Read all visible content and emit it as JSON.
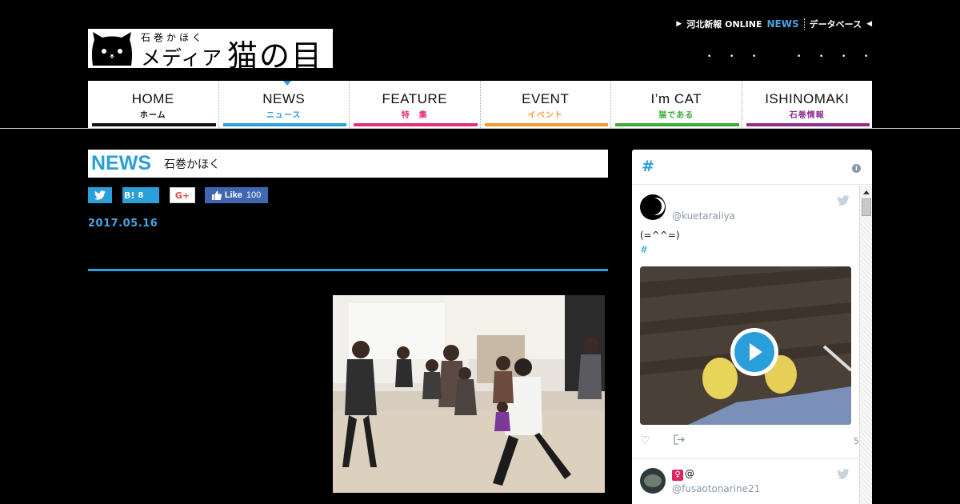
{
  "header": {
    "logo_prefix": "石巻かほく",
    "logo_media": "メディア",
    "logo_name": "猫の目",
    "toplinks": {
      "kahoku": "河北新報 ONLINE",
      "news": "NEWS",
      "database": "データベース"
    }
  },
  "nav": {
    "items": [
      {
        "en": "HOME",
        "jp": "ホーム",
        "color": "#111111"
      },
      {
        "en": "NEWS",
        "jp": "ニュース",
        "color": "#2b9fd9"
      },
      {
        "en": "FEATURE",
        "jp": "特　集",
        "color": "#e62e7b"
      },
      {
        "en": "EVENT",
        "jp": "イベント",
        "color": "#f29a2e"
      },
      {
        "en": "I’m CAT",
        "jp": "猫である",
        "color": "#3aab3a"
      },
      {
        "en": "ISHINOMAKI",
        "jp": "石巻情報",
        "color": "#8e2e8e"
      }
    ],
    "active": "NEWS"
  },
  "article": {
    "section_en": "NEWS",
    "section_jp": "石巻かほく",
    "date": "2017.05.16",
    "share": {
      "hatena_label": "B!",
      "hatena_count": "8",
      "google_label": "G+",
      "fb_label": "Like",
      "fb_count": "100"
    }
  },
  "widget": {
    "header_hash": "#",
    "tweets": [
      {
        "handle": "@kuetaraiiya",
        "text": "(=^^=)",
        "hashtag": "#",
        "count": "5"
      },
      {
        "name_prefix": "♀",
        "name": "@",
        "handle": "@fusaotonarine21"
      }
    ]
  }
}
